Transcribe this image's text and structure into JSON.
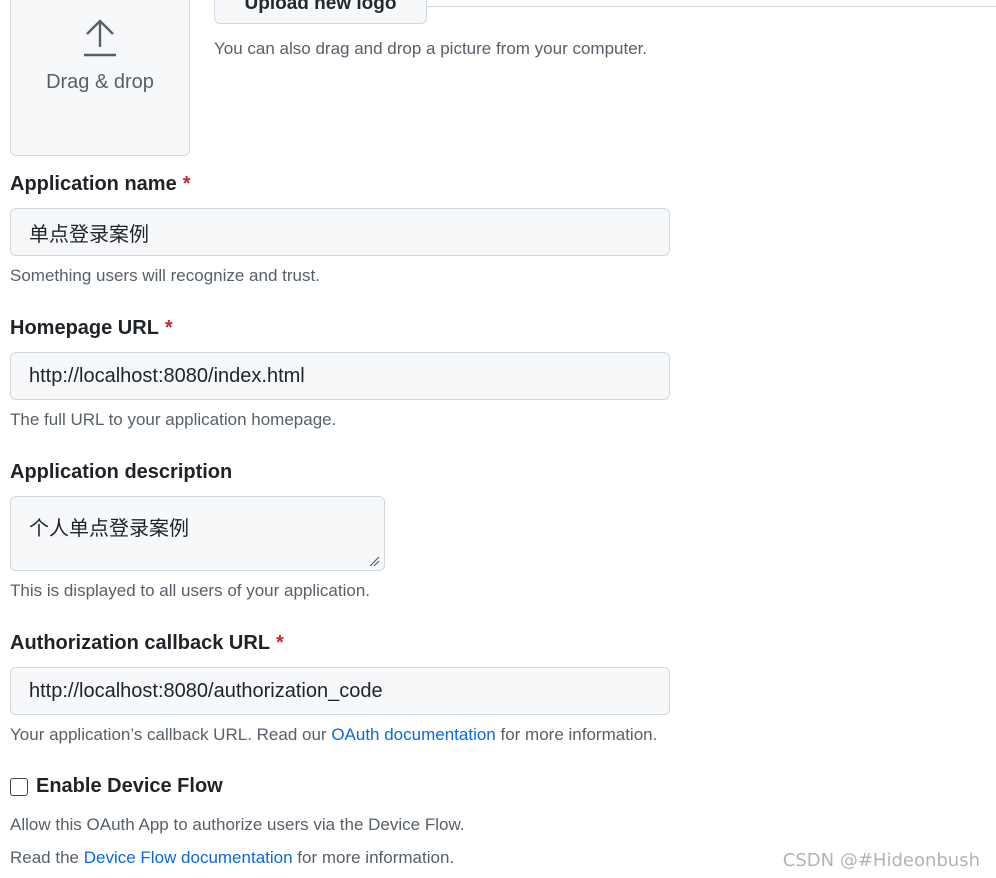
{
  "logo": {
    "drop_label": "Drag & drop",
    "upload_button": "Upload new logo",
    "hint": "You can also drag and drop a picture from your computer."
  },
  "fields": {
    "app_name": {
      "label": "Application name",
      "required_mark": "*",
      "value": "单点登录案例",
      "note": "Something users will recognize and trust."
    },
    "homepage": {
      "label": "Homepage URL",
      "required_mark": "*",
      "value": "http://localhost:8080/index.html",
      "note": "The full URL to your application homepage."
    },
    "description": {
      "label": "Application description",
      "value": "个人单点登录案例",
      "note": "This is displayed to all users of your application."
    },
    "callback": {
      "label": "Authorization callback URL",
      "required_mark": "*",
      "value": "http://localhost:8080/authorization_code",
      "note_before": "Your application’s callback URL. Read our ",
      "note_link": "OAuth documentation",
      "note_after": " for more information."
    }
  },
  "device_flow": {
    "label": "Enable Device Flow",
    "checked": false,
    "note1": "Allow this OAuth App to authorize users via the Device Flow.",
    "note2_before": "Read the ",
    "note2_link": "Device Flow documentation",
    "note2_after": " for more information."
  },
  "watermark": "CSDN @#Hideonbush",
  "colors": {
    "accent_link": "#0969da",
    "required": "#cf222e",
    "input_bg": "#f6f8fa",
    "muted_text": "#57606a"
  }
}
